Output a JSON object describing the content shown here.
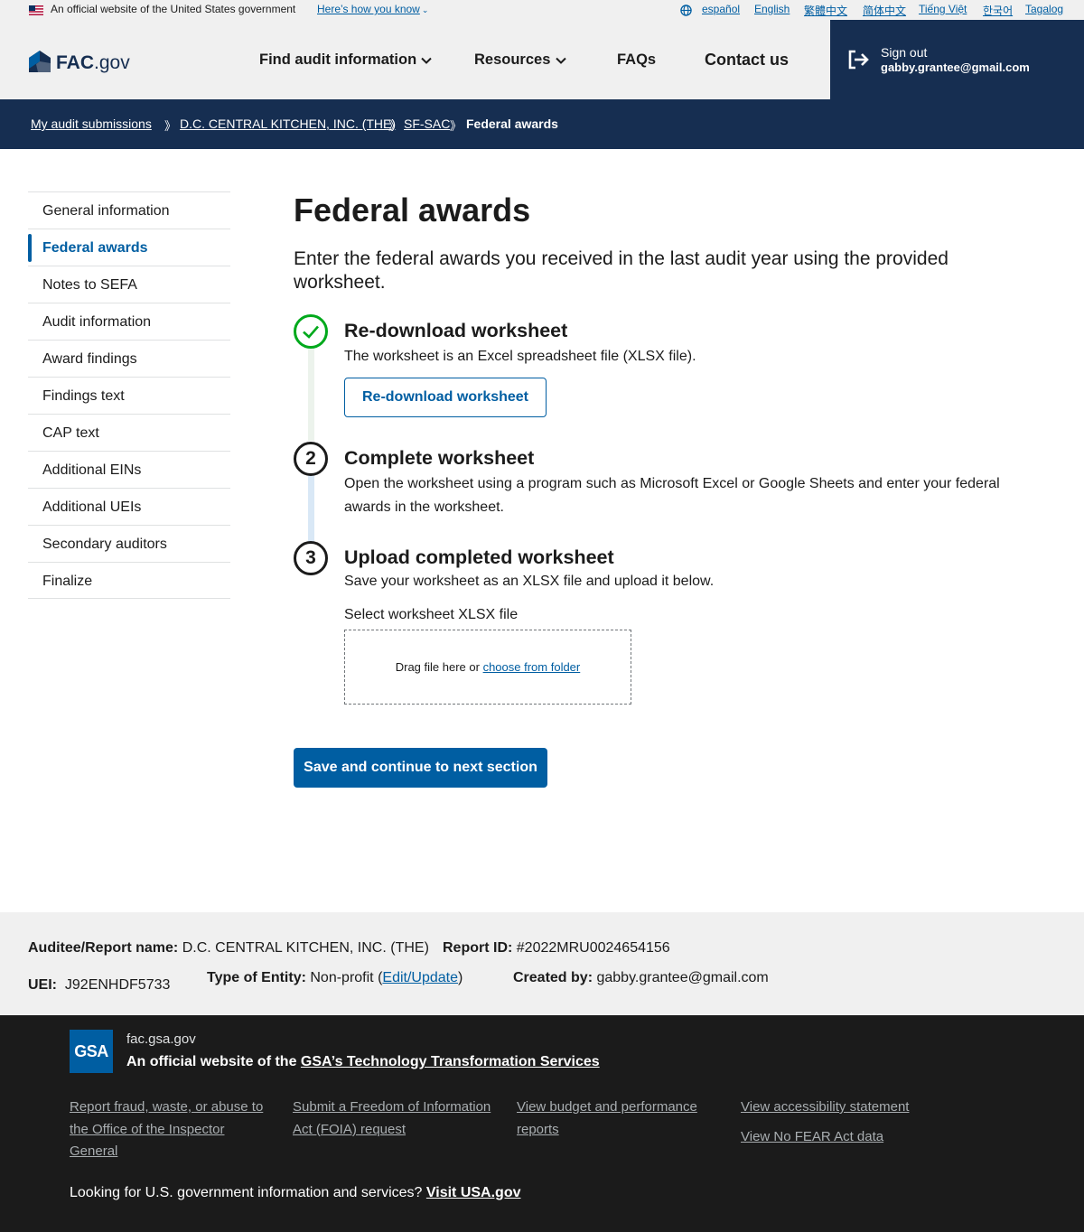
{
  "banner": {
    "official_text": "An official website of the United States government",
    "how_link": "Here’s how you know",
    "languages": [
      "español",
      "English",
      "繁體中文",
      "简体中文",
      "Tiếng Việt",
      "한국어",
      "Tagalog"
    ]
  },
  "header": {
    "logo_bold": "FAC",
    "logo_suffix": ".gov",
    "nav": [
      "Find audit information",
      "Resources",
      "FAQs",
      "Contact us"
    ],
    "signout_label": "Sign out",
    "user_email": "gabby.grantee@gmail.com"
  },
  "breadcrumb": {
    "items": [
      "My audit submissions",
      "D.C. CENTRAL KITCHEN, INC. (THE)",
      "SF-SAC",
      "Federal awards"
    ],
    "separator": "》"
  },
  "sidenav": {
    "items": [
      "General information",
      "Federal awards",
      "Notes to SEFA",
      "Audit information",
      "Award findings",
      "Findings text",
      "CAP text",
      "Additional EINs",
      "Additional UEIs",
      "Secondary auditors",
      "Finalize"
    ],
    "active_index": 1
  },
  "main": {
    "title": "Federal awards",
    "intro": "Enter the federal awards you received in the last audit year using the provided worksheet.",
    "steps": [
      {
        "title": "Re-download worksheet",
        "description": "The worksheet is an Excel spreadsheet file (XLSX file).",
        "button": "Re-download worksheet",
        "status": "complete"
      },
      {
        "number": "2",
        "title": "Complete worksheet",
        "description": "Open the worksheet using a program such as Microsoft Excel or Google Sheets and enter your federal awards in the worksheet."
      },
      {
        "number": "3",
        "title": "Upload completed worksheet",
        "description": "Save your worksheet as an XLSX file and upload it below.",
        "file_label": "Select worksheet XLSX file",
        "drop_text": "Drag file here or",
        "choose_link": "choose from folder"
      }
    ],
    "save_button": "Save and continue to next section"
  },
  "info": {
    "auditee_label": "Auditee/Report name:",
    "auditee_value": "D.C. CENTRAL KITCHEN, INC. (THE)",
    "report_id_label": "Report ID:",
    "report_id_value": "#2022MRU0024654156",
    "uei_label": "UEI:",
    "uei_value": "J92ENHDF5733",
    "entity_label": "Type of Entity:",
    "entity_value": "Non-profit",
    "entity_edit": "Edit/Update",
    "created_label": "Created by:",
    "created_value": "gabby.grantee@gmail.com"
  },
  "footer": {
    "logo_text": "GSA",
    "domain": "fac.gsa.gov",
    "official_prefix": "An official website of the",
    "official_link": "GSA’s Technology Transformation Services",
    "links": [
      "Report fraud, waste, or abuse to the Office of the Inspector General",
      "Submit a Freedom of Information Act (FOIA) request",
      "View budget and performance reports",
      "View accessibility statement",
      "View No FEAR Act data"
    ],
    "usa_prompt": "Looking for U.S. government information and services?",
    "usa_link": "Visit USA.gov"
  },
  "colors": {
    "primary": "#005ea2",
    "navy": "#162e51",
    "success": "#00a91c",
    "footer_dark": "#1b1b1b",
    "light_gray": "#f0f0f0"
  }
}
